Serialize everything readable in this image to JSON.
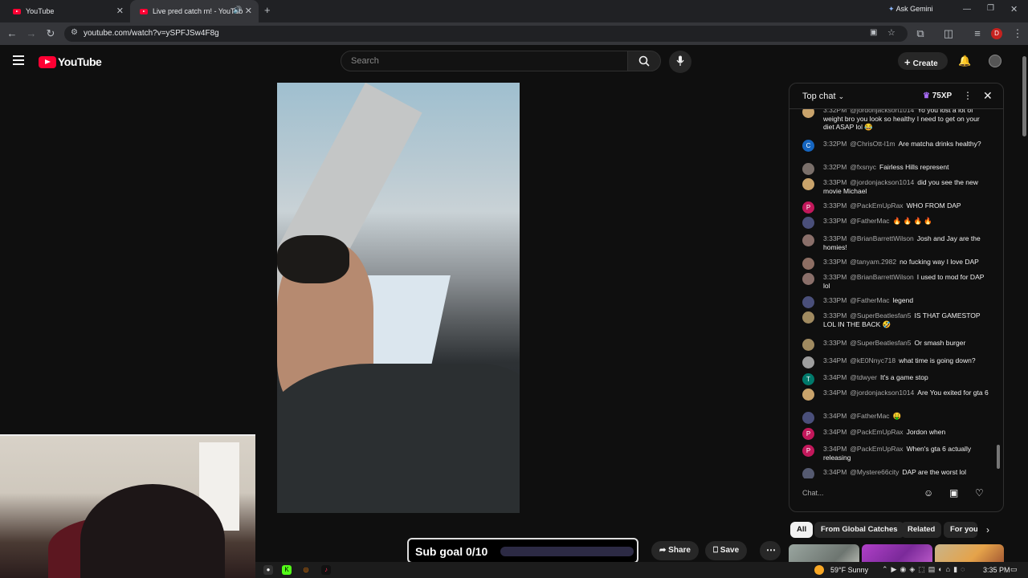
{
  "browser": {
    "tabs": [
      {
        "title": "YouTube"
      },
      {
        "title": "Live pred catch rn! - YouTub"
      }
    ],
    "new_tab": "+",
    "ask_gemini": "Ask Gemini",
    "url": "youtube.com/watch?v=ySPFJSw4F8g",
    "profile_initial": "D"
  },
  "youtube": {
    "logo_text": "YouTube",
    "search_placeholder": "Search",
    "create_label": "Create"
  },
  "chat": {
    "title": "Top chat",
    "xp": "75XP",
    "input_placeholder": "Chat...",
    "messages": [
      {
        "time": "3:32PM",
        "author": "@jordonjackson1014",
        "text": "Yo you lost a lot of weight bro you look so healthy I need to get on your diet ASAP lol 😂",
        "avatar": "",
        "avatar_color": "#c9a36b"
      },
      {
        "time": "3:32PM",
        "author": "@ChrisOtt-l1m",
        "text": "Are matcha drinks healthy?",
        "avatar": "C",
        "avatar_color": "#1565c0"
      },
      {
        "time": "3:32PM",
        "author": "@fxsnyc",
        "text": "Fairless Hills represent",
        "avatar": "",
        "avatar_color": "#7a6f6a"
      },
      {
        "time": "3:33PM",
        "author": "@jordonjackson1014",
        "text": "did you see the new movie Michael",
        "avatar": "",
        "avatar_color": "#c9a36b"
      },
      {
        "time": "3:33PM",
        "author": "@PackEmUpRax",
        "text": "WHO FROM DAP",
        "avatar": "P",
        "avatar_color": "#c2185b"
      },
      {
        "time": "3:33PM",
        "author": "@FatherMac",
        "text": "🔥 🔥 🔥 🔥",
        "avatar": "",
        "avatar_color": "#4a4f7a"
      },
      {
        "time": "3:33PM",
        "author": "@BrianBarrettWilson",
        "text": "Josh and Jay are the homies!",
        "avatar": "",
        "avatar_color": "#8a6f6a"
      },
      {
        "time": "3:33PM",
        "author": "@tanyam.2982",
        "text": "no fucking way I love DAP",
        "avatar": "",
        "avatar_color": "#8d6e63"
      },
      {
        "time": "3:33PM",
        "author": "@BrianBarrettWilson",
        "text": "I used to mod for DAP lol",
        "avatar": "",
        "avatar_color": "#8a6f6a"
      },
      {
        "time": "3:33PM",
        "author": "@FatherMac",
        "text": "legend",
        "avatar": "",
        "avatar_color": "#4a4f7a"
      },
      {
        "time": "3:33PM",
        "author": "@SuperBeatlesfan5",
        "text": "IS THAT GAMESTOP LOL IN THE BACK 🤣",
        "avatar": "",
        "avatar_color": "#a08a60"
      },
      {
        "time": "3:33PM",
        "author": "@SuperBeatlesfan5",
        "text": "Or smash burger",
        "avatar": "",
        "avatar_color": "#a08a60"
      },
      {
        "time": "3:34PM",
        "author": "@kE0Nnyc718",
        "text": "what time is going down?",
        "avatar": "",
        "avatar_color": "#9e9e9e"
      },
      {
        "time": "3:34PM",
        "author": "@tdwyer",
        "text": "It's a game stop",
        "avatar": "T",
        "avatar_color": "#00796b"
      },
      {
        "time": "3:34PM",
        "author": "@jordonjackson1014",
        "text": "Are You exited for gta 6",
        "avatar": "",
        "avatar_color": "#c9a36b"
      },
      {
        "time": "3:34PM",
        "author": "@FatherMac",
        "text": "🤑",
        "avatar": "",
        "avatar_color": "#4a4f7a"
      },
      {
        "time": "3:34PM",
        "author": "@PackEmUpRax",
        "text": "Jordon when",
        "avatar": "P",
        "avatar_color": "#c2185b"
      },
      {
        "time": "3:34PM",
        "author": "@PackEmUpRax",
        "text": "When's gta 6 actually releasing",
        "avatar": "P",
        "avatar_color": "#c2185b"
      },
      {
        "time": "3:34PM",
        "author": "@Mystere66city",
        "text": "DAP are the worst lol",
        "avatar": "",
        "avatar_color": "#555a70"
      }
    ]
  },
  "video_actions": {
    "subgoal_label": "Sub goal 0/10",
    "subgoal_progress": 0,
    "share_label": "Share",
    "save_label": "Save",
    "more_label": "⋯"
  },
  "chips": [
    "All",
    "From Global Catches",
    "Related",
    "For you"
  ],
  "taskbar": {
    "weather": "59°F  Sunny",
    "time": "3:35 PM"
  },
  "colors": {
    "brand_red": "#ff0033",
    "subgoal_fill": "#6b5ed6"
  }
}
